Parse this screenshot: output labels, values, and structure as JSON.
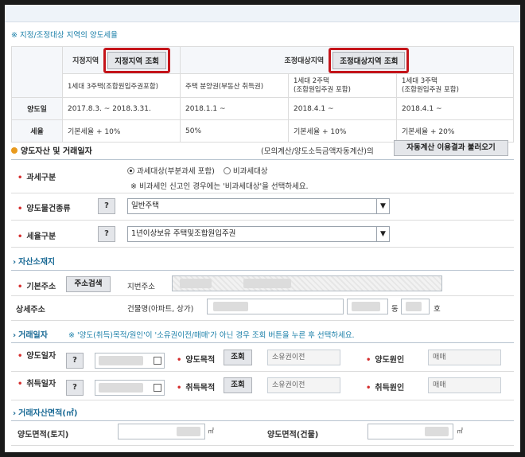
{
  "section_title": "※ 지정/조정대상 지역의 양도세율",
  "region_table": {
    "designated": {
      "label": "지정지역",
      "button": "지정지역 조회"
    },
    "adjusted": {
      "label": "조정대상지역",
      "button": "조정대상지역 조회"
    },
    "sub_headers": [
      "1세대 3주택(조합원입주권포함)",
      "주택 분양권(부동산 취득권)",
      "1세대 2주택\n(조합원입주권 포함)",
      "1세대 3주택\n(조합원입주권 포함)"
    ],
    "rows": [
      {
        "label": "양도일",
        "cells": [
          "2017.8.3. ~ 2018.3.31.",
          "2018.1.1 ~",
          "2018.4.1 ~",
          "2018.4.1 ~"
        ]
      },
      {
        "label": "세율",
        "cells": [
          "기본세율 + 10%",
          "50%",
          "기본세율 + 10%",
          "기본세율 + 20%"
        ]
      }
    ]
  },
  "asset_section": {
    "title": "양도자산 및 거래일자",
    "calc_note": "(모의계산/양도소득금액자동계산)의",
    "load_button": "자동계산 이용결과 불러오기"
  },
  "tax_class": {
    "label": "과세구분",
    "option_taxable": "과세대상(부분과세 포함)",
    "option_nontaxable": "비과세대상",
    "selected": "taxable",
    "hint": "※ 비과세인 신고인 경우에는 '비과세대상'을 선택하세요."
  },
  "property_type": {
    "label": "양도물건종류",
    "help": "?",
    "value": "일반주택"
  },
  "tax_rate_class": {
    "label": "세율구분",
    "help": "?",
    "value": "1년이상보유 주택및조합원입주권"
  },
  "location_section": {
    "title": "자산소재지",
    "basic_address_label": "기본주소",
    "address_search_button": "주소검색",
    "lot_address_label": "지번주소",
    "detail_address_label": "상세주소",
    "building_name_label": "건물명(아파트, 상가)",
    "dong_label": "동",
    "ho_label": "호"
  },
  "trade_section": {
    "title": "거래일자",
    "note": "※ '양도(취득)목적/원인'이 '소유권이전/매매'가 아닌 경우 조회 버튼을 누른 후 선택하세요.",
    "transfer_date_label": "양도일자",
    "acquire_date_label": "취득일자",
    "help": "?",
    "transfer_purpose_label": "양도목적",
    "acquire_purpose_label": "취득목적",
    "lookup_button": "조회",
    "transfer_purpose_value": "소유권이전",
    "acquire_purpose_value": "소유권이전",
    "transfer_cause_label": "양도원인",
    "acquire_cause_label": "취득원인",
    "transfer_cause_value": "매매",
    "acquire_cause_value": "매매"
  },
  "area_section": {
    "title": "거래자산면적(㎡)",
    "land_label": "양도면적(토지)",
    "building_label": "양도면적(건물)",
    "unit": "㎡"
  },
  "colors": {
    "accent": "#1a6a95",
    "highlight_border": "#c4141a",
    "required": "#d52d2d"
  }
}
